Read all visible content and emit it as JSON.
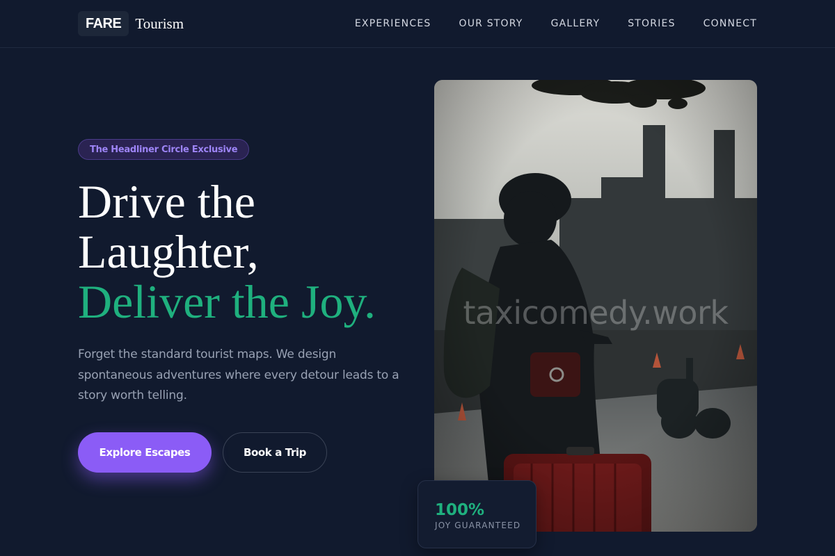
{
  "header": {
    "logo_badge": "FARE",
    "logo_word": "Tourism",
    "nav": [
      {
        "label": "EXPERIENCES"
      },
      {
        "label": "OUR STORY"
      },
      {
        "label": "GALLERY"
      },
      {
        "label": "STORIES"
      },
      {
        "label": "CONNECT"
      }
    ]
  },
  "hero": {
    "badge": "The Headliner Circle Exclusive",
    "headline": {
      "line1": "Drive the",
      "line2": "Laughter,",
      "line3": "Deliver the Joy."
    },
    "description": "Forget the standard tourist maps. We design spontaneous adventures where every detour leads to a story worth telling.",
    "primary_button": "Explore Escapes",
    "secondary_button": "Book a Trip"
  },
  "image": {
    "watermark": "taxicomedy.work"
  },
  "stat": {
    "value": "100%",
    "label": "JOY GUARANTEED"
  },
  "colors": {
    "background": "#111a2e",
    "accent_purple": "#8b5cf6",
    "accent_green": "#1fb07e"
  }
}
